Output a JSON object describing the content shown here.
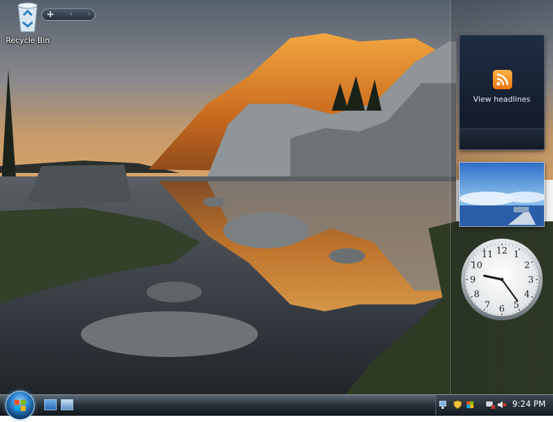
{
  "desktop": {
    "icons": [
      {
        "label": "Recycle Bin",
        "icon": "recycle-bin-icon"
      }
    ]
  },
  "sidebar": {
    "controls": {
      "add": "+",
      "prev": "‹",
      "next": "›"
    },
    "feed_gadget": {
      "headline_label": "View headlines",
      "icon": "rss-icon",
      "accent": "#f08a1c"
    },
    "slideshow_gadget": {
      "icon": "slideshow-image"
    },
    "clock_gadget": {
      "numerals": [
        "12",
        "1",
        "2",
        "3",
        "4",
        "5",
        "6",
        "7",
        "8",
        "9",
        "10",
        "11"
      ],
      "hour": 9,
      "minute": 24
    }
  },
  "taskbar": {
    "start_icon": "windows-orb-icon",
    "quicklaunch": [
      "show-desktop-icon",
      "switch-windows-icon"
    ],
    "tray_icons": [
      "network-icon",
      "security-shield-icon",
      "windows-update-icon",
      "network-connection-icon",
      "volume-muted-icon"
    ],
    "time": "9:24 PM"
  }
}
